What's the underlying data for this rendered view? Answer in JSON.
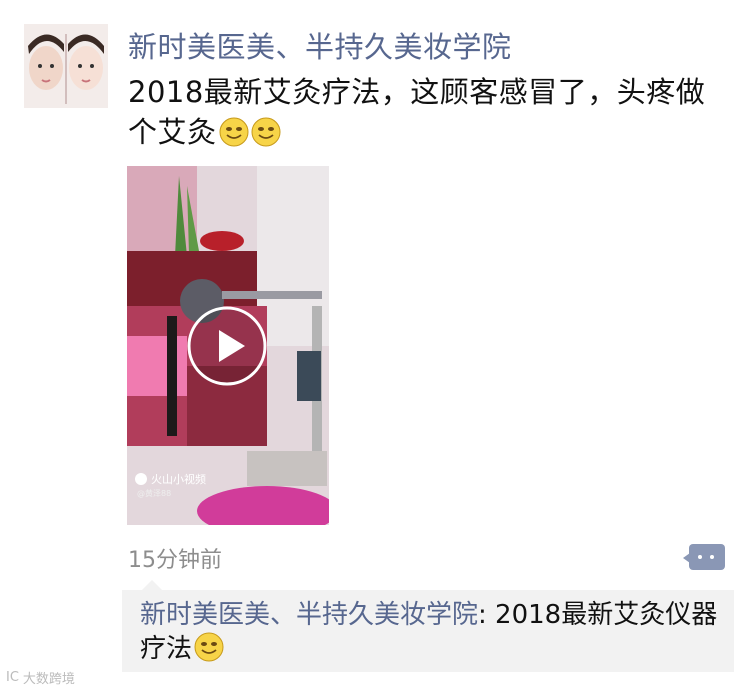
{
  "post": {
    "author": "新时美医美、半持久美妆学院",
    "text": "2018最新艾灸疗法，这顾客感冒了，头疼做个艾灸",
    "emojis": [
      "smile-emoji",
      "smile-emoji"
    ],
    "time": "15分钟前"
  },
  "video": {
    "app_label": "火山小视频",
    "app_sub": "@黄泽88"
  },
  "comment": {
    "author": "新时美医美、半持久美妆学院",
    "separator": ": ",
    "text": "2018最新艾灸仪器疗法",
    "emoji": "smile-emoji"
  },
  "watermark": {
    "icon_text": "IC",
    "text": "大数跨境"
  },
  "colors": {
    "link": "#57678f",
    "meta": "#8d8d8d",
    "comment_bg": "#f2f2f2",
    "comment_button": "#8a97b5"
  }
}
